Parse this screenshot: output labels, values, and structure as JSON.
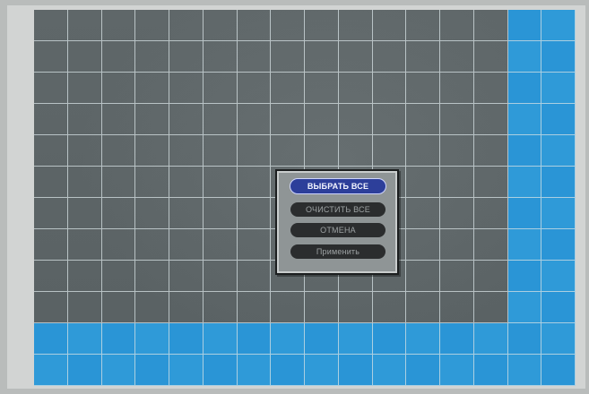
{
  "grid": {
    "columns": 16,
    "rows": 12
  },
  "colors": {
    "selected_cell": "#2a95d6",
    "grid_line": "#d7e1e4",
    "menu_panel": "#8f9596",
    "menu_button": "#2b2d2e",
    "menu_button_selected": "#2d3f9a"
  },
  "menu": {
    "items": [
      {
        "label": "ВЫБРАТЬ ВСЕ",
        "selected": true
      },
      {
        "label": "ОЧИСТИТЬ ВСЕ",
        "selected": false
      },
      {
        "label": "ОТМЕНА",
        "selected": false
      },
      {
        "label": "Применить",
        "selected": false
      }
    ]
  }
}
